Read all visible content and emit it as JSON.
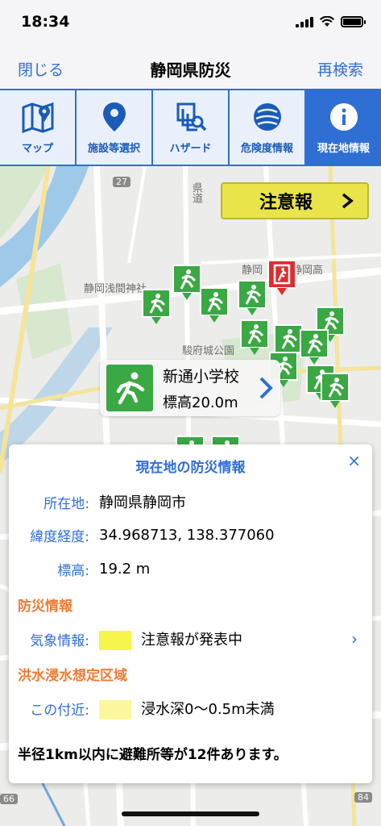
{
  "status_bar": {
    "time": "18:34"
  },
  "nav": {
    "left": "閉じる",
    "title": "静岡県防災",
    "right": "再検索"
  },
  "tabs": [
    {
      "label": "マップ",
      "icon": "map-icon"
    },
    {
      "label": "施設等選択",
      "icon": "location-pin-icon"
    },
    {
      "label": "ハザード",
      "icon": "layers-search-icon"
    },
    {
      "label": "危険度情報",
      "icon": "globe-icon"
    },
    {
      "label": "現在地情報",
      "icon": "info-icon",
      "active": true
    }
  ],
  "map": {
    "alert_button": "注意報",
    "labels": {
      "road": "県道",
      "shrine": "静岡浅間神社",
      "castle": "駿府城公園",
      "school": "静岡",
      "school2": "静岡高"
    },
    "road_numbers": [
      "27",
      "66",
      "84"
    ],
    "selected": {
      "name": "新通小学校",
      "elevation": "標高20.0m"
    }
  },
  "panel": {
    "title": "現在地の防災情報",
    "close": "×",
    "location_label": "所在地:",
    "location_value": "静岡県静岡市",
    "coords_label": "緯度経度:",
    "coords_value": "34.968713, 138.377060",
    "elev_label": "標高:",
    "elev_value": "19.2 m",
    "disaster_section": "防災情報",
    "weather_label": "気象情報:",
    "weather_value": "注意報が発表中",
    "weather_color": "#f6f54b",
    "flood_section": "洪水浸水想定区域",
    "flood_label": "この付近:",
    "flood_value": "浸水深0〜0.5m未満",
    "flood_color": "#fbf79a",
    "footnote": "半径1km以内に避難所等が12件あります。"
  }
}
